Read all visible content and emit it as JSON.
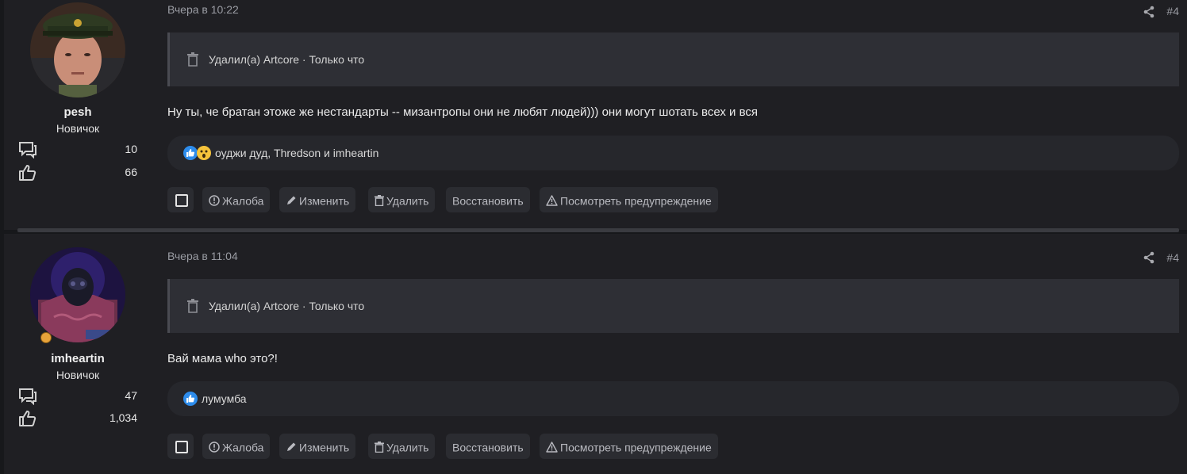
{
  "colors": {
    "background": "#17181b",
    "post_background": "#1f1f23",
    "deleted_bg": "#2e2f35",
    "reaction_bg": "#26272c",
    "button_bg": "#2b2c31",
    "like_blue": "#2d8ceb",
    "wow_yellow": "#f5c33b"
  },
  "posts": [
    {
      "user": {
        "name": "pesh",
        "rank": "Новичок",
        "messages": "10",
        "reactions": "66",
        "avatar": "avatar-photo"
      },
      "time": "Вчера в 10:22",
      "number": "#4",
      "deleted_notice": "Удалил(а) Artcore · Только что",
      "message": "Ну ты, че братан этоже же нестандарты -- мизантропы они не любят людей))) они могут шотать всех и вся",
      "reactions_text": "оуджи дуд, Thredson и imheartin",
      "reaction_icons": [
        "like-icon",
        "wow-icon"
      ]
    },
    {
      "user": {
        "name": "imheartin",
        "rank": "Новичок",
        "messages": "47",
        "reactions": "1,034",
        "avatar": "avatar-photo"
      },
      "time": "Вчера в 11:04",
      "number": "#4",
      "deleted_notice": "Удалил(а) Artcore · Только что",
      "message": "Вай мама who это?!",
      "reactions_text": "лумумба",
      "reaction_icons": [
        "like-icon"
      ]
    }
  ],
  "actions": {
    "report": "Жалоба",
    "edit": "Изменить",
    "delete": "Удалить",
    "restore": "Восстановить",
    "view_warning": "Посмотреть предупреждение"
  }
}
